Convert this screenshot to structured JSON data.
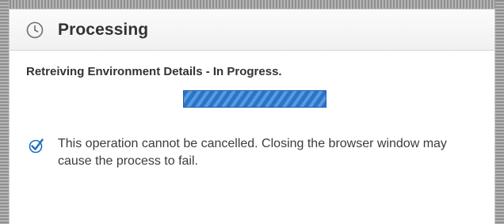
{
  "dialog": {
    "title": "Processing",
    "title_icon": "clock-icon",
    "status": "Retreiving Environment Details - In Progress.",
    "progress": {
      "state": "indeterminate",
      "color": "#2a74c9"
    },
    "notice": {
      "icon": "check-icon",
      "icon_color": "#1f6fc0",
      "text": "This operation cannot be cancelled. Closing the browser window may cause the process to fail."
    }
  }
}
